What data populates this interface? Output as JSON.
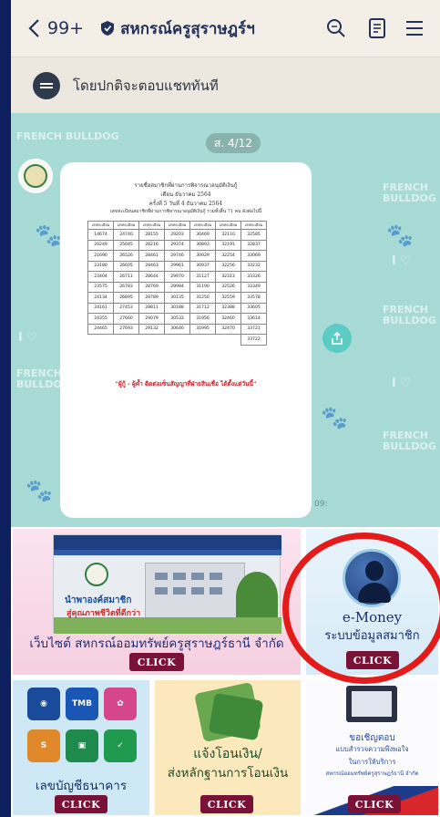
{
  "header": {
    "unread_count": "99+",
    "title": "สหกรณ์ครูสุราษฎร์ฯ"
  },
  "notice": {
    "text": "โดยปกติจะตอบแชททันที"
  },
  "chat": {
    "date_pill": "ส. 4/12",
    "time": "09:",
    "pattern_text": "FRENCH BULLDOG",
    "pattern_love": "I ♡",
    "document": {
      "line1": "รายชื่อสมาชิกที่ผ่านการพิจารณาอนุมัติเงินกู้",
      "line2": "เดือน ธันวาคม 2564",
      "line3": "ครั้งที่ 5 วันที่ 4 ธันวาคม 2564",
      "line4": "เลขทะเบียนสมาชิกที่ผ่านการพิจารณาอนุมัติเงินกู้ รวมทั้งสิ้น 71 คน ดังต่อไปนี้",
      "column_header": "เลขทะเบียน",
      "rows": [
        [
          "14674",
          "24740",
          "28155",
          "29203",
          "30469",
          "32110",
          "32585"
        ],
        [
          "20249",
          "25045",
          "28216",
          "29374",
          "30893",
          "32191",
          "32837"
        ],
        [
          "21690",
          "26526",
          "28461",
          "29746",
          "30929",
          "32254",
          "33069"
        ],
        [
          "23180",
          "26605",
          "28463",
          "29961",
          "30937",
          "32256",
          "33232"
        ],
        [
          "23404",
          "26711",
          "28644",
          "29970",
          "31127",
          "32313",
          "33326"
        ],
        [
          "23575",
          "26783",
          "28769",
          "29984",
          "31190",
          "32526",
          "33349"
        ],
        [
          "24134",
          "26895",
          "28789",
          "30135",
          "31250",
          "32559",
          "33578"
        ],
        [
          "24161",
          "27453",
          "28811",
          "30188",
          "31712",
          "32388",
          "33605"
        ],
        [
          "24355",
          "27660",
          "29079",
          "30533",
          "31956",
          "32460",
          "33614"
        ],
        [
          "24465",
          "27693",
          "29132",
          "30646",
          "31995",
          "32470",
          "33721"
        ],
        [
          "",
          "",
          "",
          "",
          "",
          "",
          "33722"
        ]
      ],
      "note": "\"ผู้กู้ - ผู้ค้ำ ติดต่อเซ็นสัญญาที่ฝ่ายสินเชื่อ ได้ตั้งแต่วันนี้\""
    }
  },
  "rich_menu": {
    "website": {
      "caption": "เว็บไซต์ สหกรณ์ออมทรัพย์ครูสุราษฎร์ธานี จำกัด",
      "button": "CLICK",
      "screenshot_line1": "นำพาองค์สมาชิก",
      "screenshot_line2": "สู่คุณภาพชีวิตที่ดีกว่า"
    },
    "emoney": {
      "title": "e-Money",
      "subtitle": "ระบบข้อมูลสมาชิก",
      "button": "CLICK"
    },
    "bank": {
      "caption": "เลขบัญชีธนาคาร",
      "button": "CLICK",
      "tmb_label": "TMB"
    },
    "transfer": {
      "line1": "แจ้งโอนเงิน/",
      "line2": "ส่งหลักฐานการโอนเงิน",
      "button": "CLICK"
    },
    "survey": {
      "line1": "ขอเชิญตอบ",
      "line2": "แบบสำรวจความพึงพอใจ",
      "line3": "ในการให้บริการ",
      "line4": "สหกรณ์ออมทรัพย์ครูสุราษฎร์ธานี จำกัด",
      "button": "CLICK"
    }
  },
  "colors": {
    "header_bg": "#f3efe6",
    "chat_bg": "#a8dbd6",
    "click_button": "#7a1237",
    "highlight_ring": "#e41b1b"
  }
}
